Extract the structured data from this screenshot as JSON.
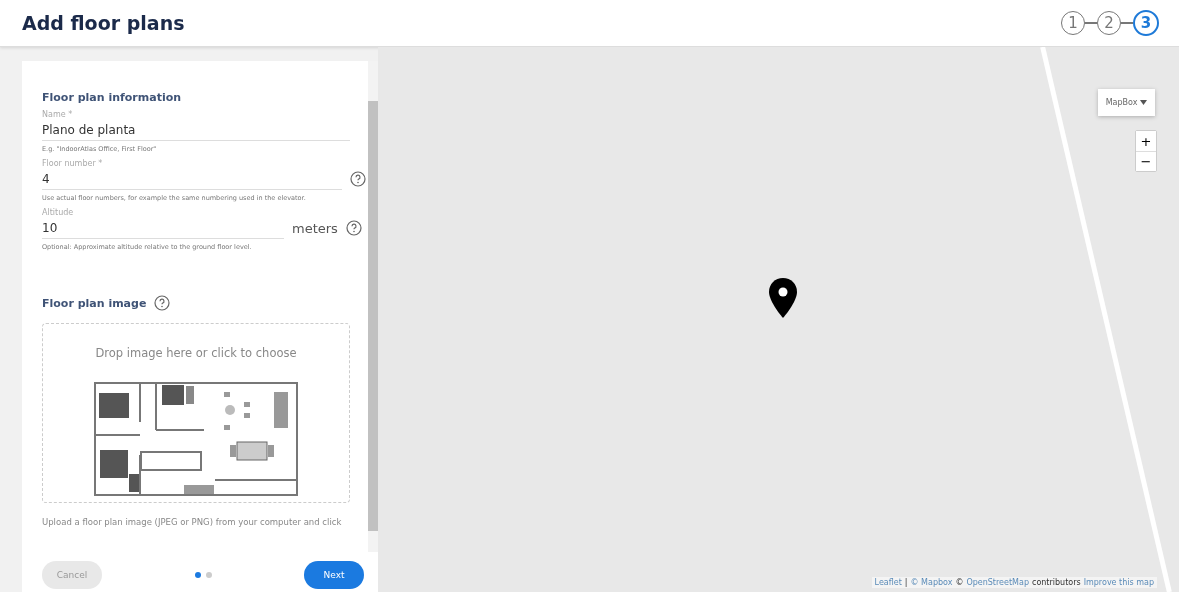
{
  "header": {
    "title": "Add floor plans",
    "steps": [
      {
        "label": "1",
        "selected": false
      },
      {
        "label": "2",
        "selected": false
      },
      {
        "label": "3",
        "selected": true
      }
    ]
  },
  "form": {
    "section_title": "Floor plan information",
    "fields": [
      {
        "label": "Name *",
        "value": "Plano de planta",
        "hint": "E.g. \"IndoorAtlas Office, First Floor\"",
        "help": false
      },
      {
        "label": "Floor number *",
        "value": "4",
        "hint": "Use actual floor numbers, for example the same numbering used in the elevator.",
        "help": true
      },
      {
        "label": "Altitude",
        "value": "10",
        "unit": "meters",
        "hint": "Optional: Approximate altitude relative to the ground floor level.",
        "help": true
      }
    ],
    "image_section_title": "Floor plan image",
    "drop_text": "Drop image here or click to choose",
    "upload_hint": "Upload a floor plan image (JPEG or PNG) from your computer and click"
  },
  "footer": {
    "cancel": "Cancel",
    "next": "Next",
    "pages": [
      {
        "selected": true
      },
      {
        "selected": false
      }
    ]
  },
  "map": {
    "layer_button": "MapBox",
    "zoom_in": "+",
    "zoom_out": "−",
    "attribution": [
      {
        "text": "Leaflet",
        "link": true
      },
      {
        "text": "|",
        "link": false
      },
      {
        "text": "© Mapbox",
        "link": true
      },
      {
        "text": "©",
        "link": false
      },
      {
        "text": "OpenStreetMap",
        "link": true
      },
      {
        "text": "contributors",
        "link": false
      },
      {
        "text": "Improve this map",
        "link": true
      }
    ]
  }
}
